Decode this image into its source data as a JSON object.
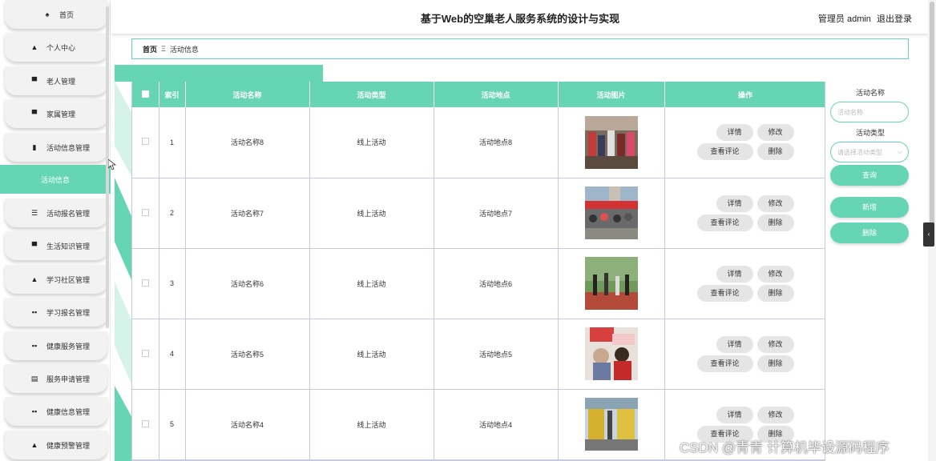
{
  "header": {
    "title": "基于Web的空巢老人服务系统的设计与实现",
    "user_label": "管理员 admin",
    "logout": "退出登录"
  },
  "sidebar": {
    "items": [
      {
        "label": "首页",
        "icon": "home-icon",
        "glyph": "♠"
      },
      {
        "label": "个人中心",
        "icon": "person-icon",
        "glyph": "▲"
      },
      {
        "label": "老人管理",
        "icon": "monitor-icon",
        "glyph": "▀"
      },
      {
        "label": "家属管理",
        "icon": "monitor-icon",
        "glyph": "▀"
      },
      {
        "label": "活动信息管理",
        "icon": "bar-chart-icon",
        "glyph": "▮"
      },
      {
        "label": "活动信息",
        "icon": "",
        "glyph": ""
      },
      {
        "label": "活动报名管理",
        "icon": "list-icon",
        "glyph": "☰"
      },
      {
        "label": "生活知识管理",
        "icon": "monitor-icon",
        "glyph": "▀"
      },
      {
        "label": "学习社区管理",
        "icon": "person-icon",
        "glyph": "▲"
      },
      {
        "label": "学习报名管理",
        "icon": "grid-icon",
        "glyph": "▪▪"
      },
      {
        "label": "健康服务管理",
        "icon": "grid-alt-icon",
        "glyph": "▪▪"
      },
      {
        "label": "服务申请管理",
        "icon": "document-icon",
        "glyph": "▤"
      },
      {
        "label": "健康信息管理",
        "icon": "grid-icon",
        "glyph": "▪▪"
      },
      {
        "label": "健康预警管理",
        "icon": "person-icon",
        "glyph": "▲"
      }
    ]
  },
  "breadcrumb": {
    "home": "首页",
    "separator": "Ξ",
    "current": "活动信息"
  },
  "table": {
    "headers": [
      "索引",
      "活动名称",
      "活动类型",
      "活动地点",
      "活动图片",
      "操作"
    ],
    "rows": [
      {
        "index": "1",
        "name": "活动名称8",
        "type": "线上活动",
        "location": "活动地点8"
      },
      {
        "index": "2",
        "name": "活动名称7",
        "type": "线上活动",
        "location": "活动地点7"
      },
      {
        "index": "3",
        "name": "活动名称6",
        "type": "线上活动",
        "location": "活动地点6"
      },
      {
        "index": "4",
        "name": "活动名称5",
        "type": "线上活动",
        "location": "活动地点5"
      },
      {
        "index": "5",
        "name": "活动名称4",
        "type": "线上活动",
        "location": "活动地点4"
      }
    ],
    "actions": {
      "detail": "详情",
      "edit": "修改",
      "comments": "查看评论",
      "delete": "删除"
    }
  },
  "search": {
    "name_label": "活动名称",
    "name_placeholder": "活动名称",
    "type_label": "活动类型",
    "type_placeholder": "请选择活动类型",
    "query": "查询",
    "add": "新增",
    "delete": "删除"
  },
  "watermark": "CSDN @青青  计算机毕设源码程序",
  "colors": {
    "accent": "#66d5b4",
    "border": "#c7cbe0"
  }
}
